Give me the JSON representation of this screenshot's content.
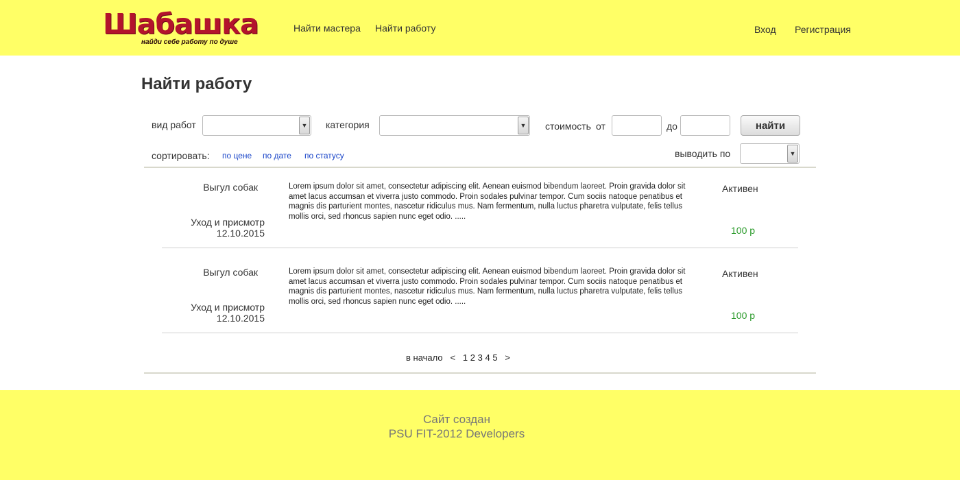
{
  "header": {
    "logo_title": "Шабашка",
    "logo_subtitle": "найди себе работу по душе",
    "nav": [
      {
        "label": "Найти мастера"
      },
      {
        "label": "Найти работу"
      }
    ],
    "auth": [
      {
        "label": "Вход"
      },
      {
        "label": "Регистрация"
      }
    ],
    "bg_color": "#ffff66"
  },
  "main": {
    "title": "Найти работу",
    "filters": {
      "work_type_label": "вид работ",
      "category_label": "категория",
      "cost_label": "стоимость",
      "from_label": "от",
      "to_label": "до",
      "find_button": "найти",
      "sort_label": "сортировать:",
      "sort_options": [
        "по цене",
        "по дате",
        "по статусу"
      ],
      "per_page_label": "выводить по"
    },
    "jobs": [
      {
        "kind": "Выгул собак",
        "category": "Уход и присмотр",
        "date": "12.10.2015",
        "description": "Lorem ipsum dolor sit amet, consectetur adipiscing elit. Aenean euismod bibendum laoreet. Proin gravida dolor sit amet lacus accumsan et viverra justo commodo. Proin sodales pulvinar tempor. Cum sociis natoque penatibus et magnis dis parturient montes, nascetur ridiculus mus. Nam fermentum, nulla luctus pharetra vulputate, felis tellus mollis orci, sed rhoncus sapien nunc eget odio. .....",
        "status": "Активен",
        "price": "100 р"
      },
      {
        "kind": "Выгул собак",
        "category": "Уход и присмотр",
        "date": "12.10.2015",
        "description": "Lorem ipsum dolor sit amet, consectetur adipiscing elit. Aenean euismod bibendum laoreet. Proin gravida dolor sit amet lacus accumsan et viverra justo commodo. Proin sodales pulvinar tempor. Cum sociis natoque penatibus et magnis dis parturient montes, nascetur ridiculus mus. Nam fermentum, nulla luctus pharetra vulputate, felis tellus mollis orci, sed rhoncus sapien nunc eget odio. .....",
        "status": "Активен",
        "price": "100 р"
      }
    ],
    "pager": {
      "first": "в начало",
      "prev": "<",
      "pages": [
        "1",
        "2",
        "3",
        "4",
        "5"
      ],
      "next": ">"
    }
  },
  "footer": {
    "line1": "Сайт создан",
    "line2": "PSU FIT-2012 Developers"
  },
  "colors": {
    "accent_yellow": "#ffff66",
    "link_blue": "#1844c8",
    "price_green": "#2a9a2a",
    "logo_red": "#b3142c"
  }
}
